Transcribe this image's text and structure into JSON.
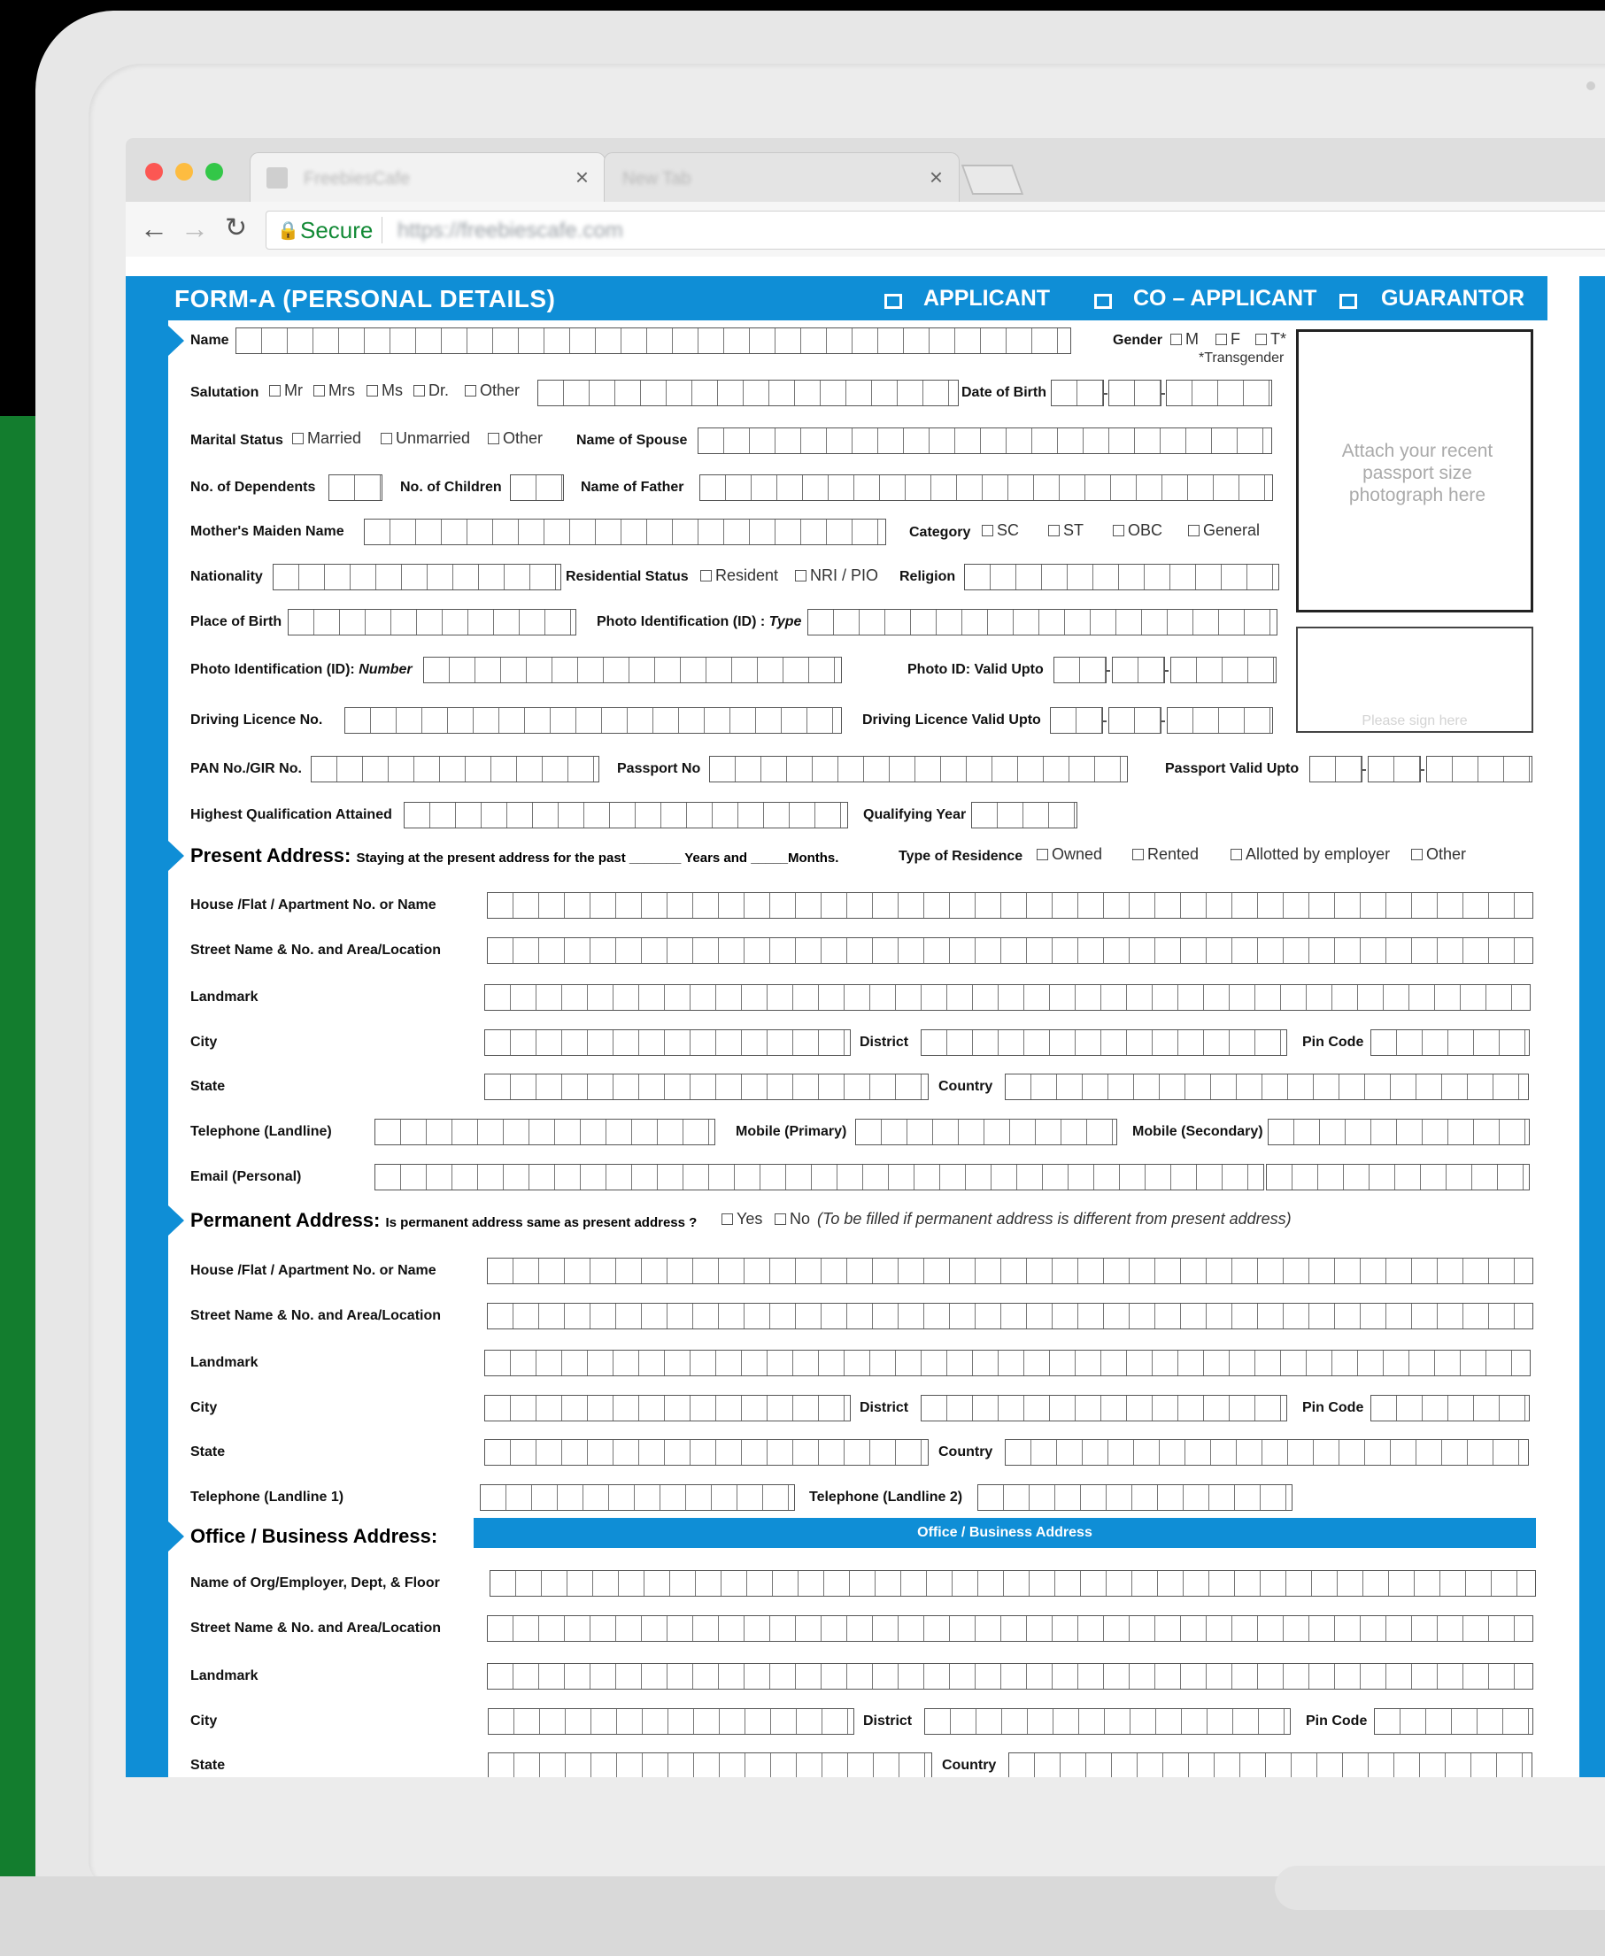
{
  "browser": {
    "tab1_title": "FreebiesCafe",
    "tab2_title": "New Tab",
    "tab_close": "×",
    "secure_label": "Secure",
    "url": "https://freebiescafe.com"
  },
  "form": {
    "title": "FORM-A  (PERSONAL DETAILS)",
    "roles": [
      "APPLICANT",
      "CO – APPLICANT",
      "GUARANTOR"
    ],
    "photo_text": "Attach your recent passport size photograph here",
    "sign_text": "Please sign here",
    "labels": {
      "name": "Name",
      "gender": "Gender",
      "gender_m": "M",
      "gender_f": "F",
      "gender_t": "T*",
      "transgender_note": "*Transgender",
      "salutation": "Salutation",
      "sal_mr": "Mr",
      "sal_mrs": "Mrs",
      "sal_ms": "Ms",
      "sal_dr": "Dr.",
      "sal_other": "Other",
      "dob": "Date of Birth",
      "marital": "Marital Status",
      "married": "Married",
      "unmarried": "Unmarried",
      "marital_other": "Other",
      "spouse": "Name of Spouse",
      "dependents": "No. of Dependents",
      "children": "No. of Children",
      "father": "Name of Father",
      "maiden": "Mother's Maiden Name",
      "category": "Category",
      "cat_sc": "SC",
      "cat_st": "ST",
      "cat_obc": "OBC",
      "cat_general": "General",
      "nationality": "Nationality",
      "res_status": "Residential Status",
      "resident": "Resident",
      "nri": "NRI / PIO",
      "religion": "Religion",
      "birthplace": "Place of Birth",
      "photo_id_type_a": "Photo Identification (ID) : ",
      "photo_id_type_b": "Type",
      "photo_id_num_a": "Photo Identification (ID): ",
      "photo_id_num_b": "Number",
      "photo_id_valid": "Photo ID: Valid Upto",
      "dl_no": "Driving Licence No.",
      "dl_valid": "Driving Licence Valid Upto",
      "pan": "PAN No./GIR No.",
      "passport": "Passport No",
      "passport_valid": "Passport Valid Upto",
      "qualification": "Highest Qualification Attained",
      "qual_year": "Qualifying Year"
    },
    "present": {
      "heading": "Present Address:",
      "staying": "Staying at the present address for the past _______ Years and _____Months.",
      "residence_type": "Type of Residence",
      "owned": "Owned",
      "rented": "Rented",
      "allotted": "Allotted by employer",
      "other": "Other",
      "house": "House /Flat / Apartment No. or Name",
      "street": "Street Name & No. and Area/Location",
      "landmark": "Landmark",
      "city": "City",
      "district": "District",
      "pin": "Pin Code",
      "state": "State",
      "country": "Country",
      "telephone": "Telephone (Landline)",
      "mobile1": "Mobile (Primary)",
      "mobile2": "Mobile (Secondary)",
      "email": "Email (Personal)"
    },
    "permanent": {
      "heading": "Permanent Address:",
      "question": "Is permanent address same as present address ?",
      "yes": "Yes",
      "no": "No",
      "note": "(To be filled if permanent address is different from present address)",
      "house": "House /Flat / Apartment No. or Name",
      "street": "Street Name & No. and Area/Location",
      "landmark": "Landmark",
      "city": "City",
      "district": "District",
      "pin": "Pin Code",
      "state": "State",
      "country": "Country",
      "tel1": "Telephone (Landline 1)",
      "tel2": "Telephone  (Landline 2)"
    },
    "office": {
      "heading": "Office / Business Address:",
      "bar": "Office / Business Address",
      "org": "Name of Org/Employer, Dept, & Floor",
      "street": "Street Name & No. and Area/Location",
      "landmark": "Landmark",
      "city": "City",
      "district": "District",
      "pin": "Pin Code",
      "state": "State",
      "country": "Country"
    }
  },
  "colors": {
    "brand_blue": "#0f8ed6",
    "green_strip": "#137d2e",
    "secure_green": "#138a36"
  }
}
